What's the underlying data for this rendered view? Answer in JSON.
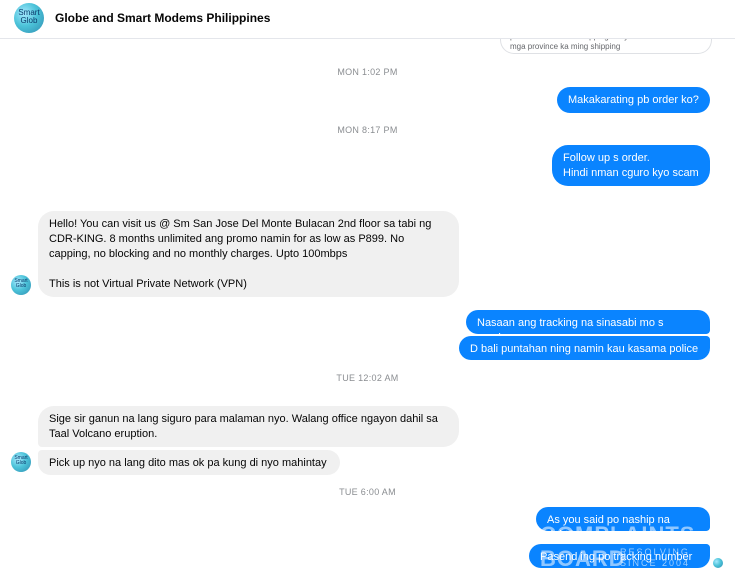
{
  "header": {
    "title": "Globe and Smart Modems Philippines",
    "avatar_text": "Smart Glob"
  },
  "previous_message": {
    "line1": "para makamura sa shipping. May",
    "line2": "mga province ka   ming shipping"
  },
  "timestamps": {
    "t1": "MON 1:02 PM",
    "t2": "MON 8:17 PM",
    "t3": "TUE 12:02 AM",
    "t4": "TUE 6:00 AM"
  },
  "messages": {
    "m1": "Makakarating pb order ko?",
    "m2_line1": "Follow up s order.",
    "m2_line2": "Hindi nman cguro kyo scam",
    "m3_line1": "Hello! You can visit us @ Sm San Jose Del Monte Bulacan 2nd floor sa tabi ng",
    "m3_line2": "CDR-KING. 8 months unlimited ang promo namin for as low as P899. No",
    "m3_line3": "capping, no blocking and no monthly charges. Upto 100mbps",
    "m3_line4": "This is not Virtual Private Network (VPN)",
    "m4": "Nasaan ang tracking na sinasabi mo s courier",
    "m5": "D bali puntahan ning namin kau kasama police",
    "m6_line1": "Sige sir ganun na lang siguro para malaman nyo. Walang office ngayon dahil sa",
    "m6_line2": "Taal Volcano eruption.",
    "m7": "Pick up nyo na lang dito mas ok pa kung di nyo mahintay",
    "m8": "As you said po naship na right?",
    "m9": "Pasend ing po tracking number"
  },
  "watermark": {
    "big1": "COMPLAINTS",
    "big2": "BOARD",
    "small1": "RESOLVING",
    "small2": "SINCE 2004"
  },
  "colors": {
    "outgoing": "#0a84ff",
    "incoming": "#f0f0f0",
    "timestamp": "#8a8d91"
  }
}
